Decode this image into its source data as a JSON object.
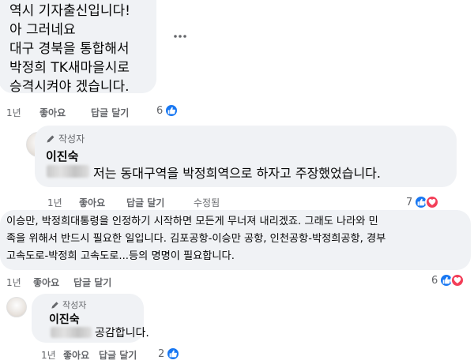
{
  "comment1": {
    "lines": [
      "역시 기자출신입니다!",
      "아 그러네요",
      "대구 경북을 통합해서",
      "박정희 TK새마을시로",
      "승격시켜야 겠습니다."
    ],
    "time": "1년",
    "like_label": "좋아요",
    "reply_label": "답글 달기",
    "reaction_count": "6"
  },
  "reply1": {
    "badge": "작성자",
    "author": "이진숙",
    "text": "저는 동대구역을 박정희역으로 하자고 주장했었습니다.",
    "time": "1년",
    "like_label": "좋아요",
    "reply_label": "답글 달기",
    "edited_label": "수정됨",
    "reaction_count": "7"
  },
  "comment2": {
    "lines": [
      "이승만, 박정희대통령을 인정하기 시작하면 모든게 무너져 내리겠죠. 그래도 나라와 민",
      "족을 위해서 반드시 필요한 일입니다. 김포공항-이승만 공항, 인천공항-박정희공항, 경부",
      "고속도로-박정희 고속도로...등의 명명이 필요합니다."
    ],
    "time": "1년",
    "like_label": "좋아요",
    "reply_label": "답글 달기",
    "reaction_count": "6"
  },
  "reply2": {
    "badge": "작성자",
    "author": "이진숙",
    "text": "공감합니다.",
    "time": "1년",
    "like_label": "좋아요",
    "reply_label": "답글 달기",
    "reaction_count": "2"
  },
  "colors": {
    "like_blue": "#1877f2",
    "love_red": "#f33e58",
    "bubble_gray": "#f0f2f5",
    "meta_gray": "#65676b"
  },
  "icons": {
    "more": "more-horizontal-icon",
    "like": "thumbs-up-icon",
    "love": "heart-icon",
    "badge": "pen-icon"
  }
}
